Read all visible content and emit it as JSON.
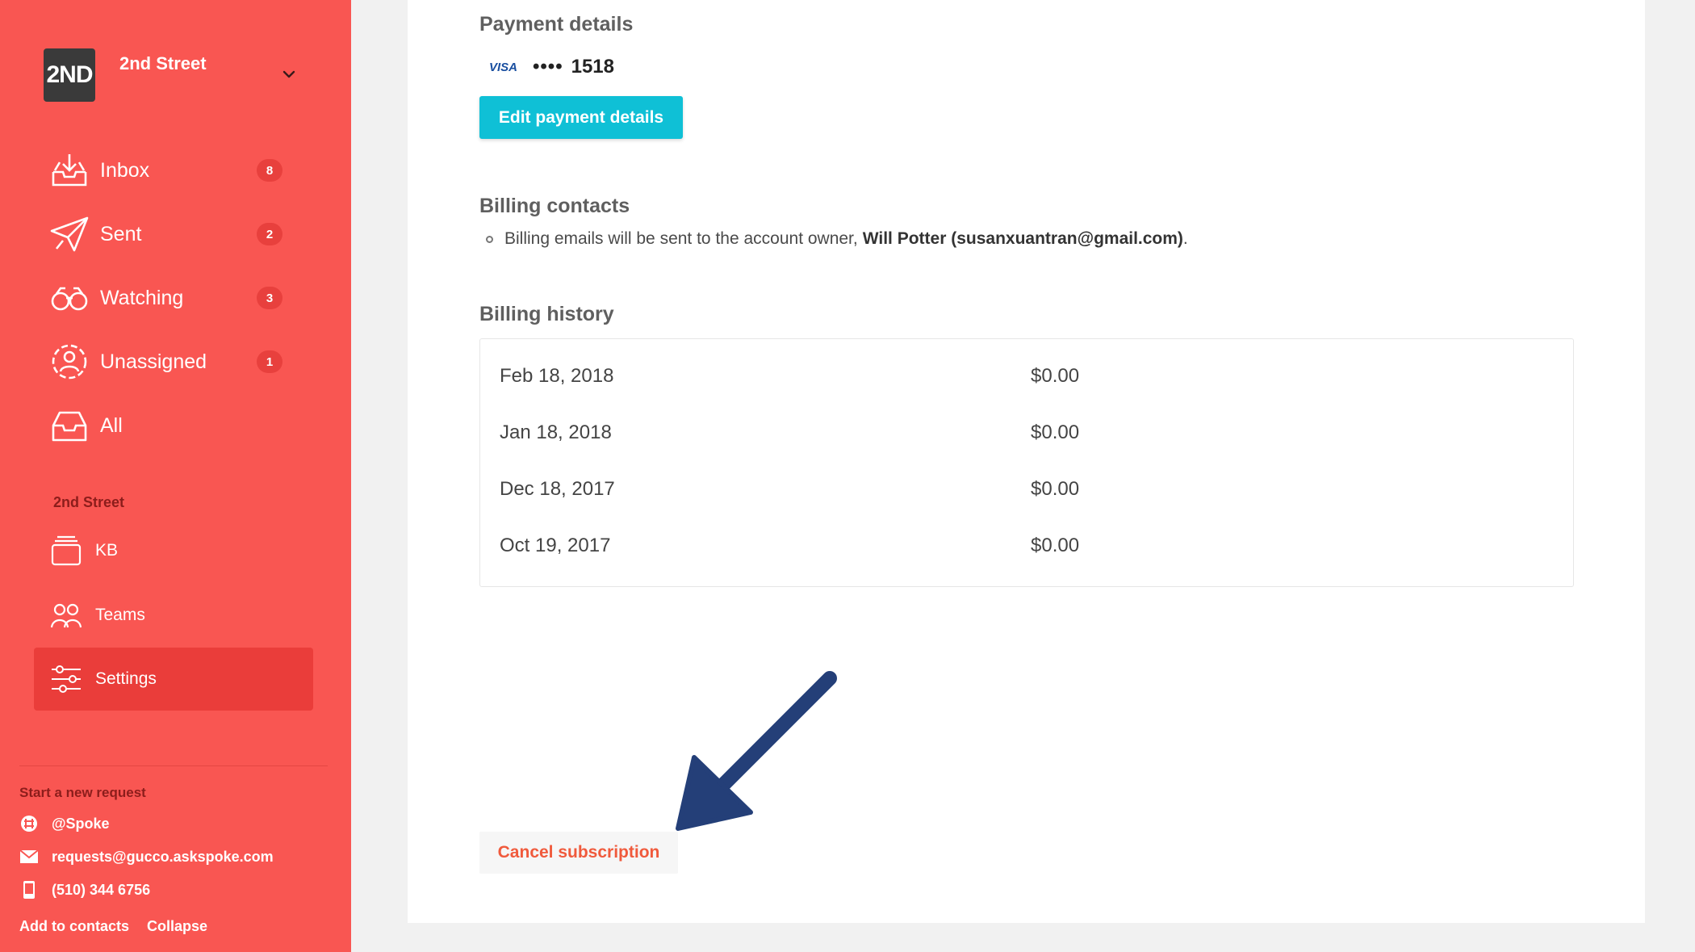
{
  "sidebar": {
    "org_logo_text": "2ND",
    "org_name": "2nd Street",
    "nav": [
      {
        "label": "Inbox",
        "badge": "8",
        "icon": "inbox-icon"
      },
      {
        "label": "Sent",
        "badge": "2",
        "icon": "paper-plane-icon"
      },
      {
        "label": "Watching",
        "badge": "3",
        "icon": "binoculars-icon"
      },
      {
        "label": "Unassigned",
        "badge": "1",
        "icon": "unassigned-user-icon"
      },
      {
        "label": "All",
        "badge": "",
        "icon": "tray-icon"
      }
    ],
    "section_title": "2nd Street",
    "section_items": [
      {
        "label": "KB",
        "icon": "stack-icon"
      },
      {
        "label": "Teams",
        "icon": "people-icon"
      },
      {
        "label": "Settings",
        "icon": "sliders-icon"
      }
    ],
    "request": {
      "title": "Start a new request",
      "slack": "@Spoke",
      "email": "requests@gucco.askspoke.com",
      "phone": "(510) 344 6756"
    },
    "footer": {
      "add_contacts": "Add to contacts",
      "collapse": "Collapse"
    }
  },
  "main": {
    "payment": {
      "heading": "Payment details",
      "card_brand": "VISA",
      "card_mask": "••••",
      "card_last4": "1518",
      "edit_button": "Edit payment details"
    },
    "contacts": {
      "heading": "Billing contacts",
      "text_before": "Billing emails will be sent to the account owner, ",
      "owner": "Will Potter (susanxuantran@gmail.com)",
      "text_after": "."
    },
    "history": {
      "heading": "Billing history",
      "rows": [
        {
          "date": "Feb 18, 2018",
          "amount": "$0.00"
        },
        {
          "date": "Jan 18, 2018",
          "amount": "$0.00"
        },
        {
          "date": "Dec 18, 2017",
          "amount": "$0.00"
        },
        {
          "date": "Oct 19, 2017",
          "amount": "$0.00"
        }
      ]
    },
    "cancel_button": "Cancel subscription"
  },
  "colors": {
    "sidebar_bg": "#f95652",
    "accent_button": "#0fc0d6",
    "cancel_text": "#f05a3c",
    "arrow": "#243f78"
  }
}
